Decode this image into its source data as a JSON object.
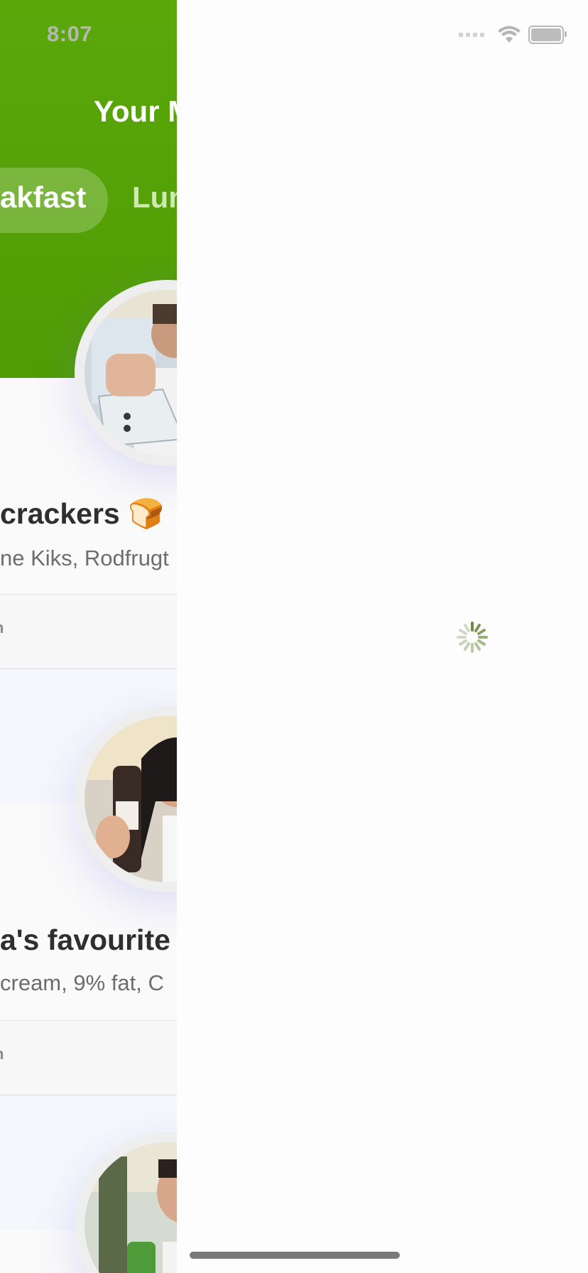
{
  "status_bar": {
    "time": "8:07"
  },
  "header": {
    "title": "Your M",
    "tabs": [
      {
        "label": "akfast",
        "active": true
      },
      {
        "label": "Lun",
        "active": false
      }
    ]
  },
  "meals": [
    {
      "title": "crackers",
      "emoji": "🍞",
      "subtitle": "ne Kiks, Rodfrugt",
      "action": "n"
    },
    {
      "title": "a's favourite",
      "subtitle": "cream, 9% fat, C",
      "action": "n"
    }
  ],
  "colors": {
    "header_green": "#5aa80a",
    "overlay_bg": "#fdfdfd",
    "spinner": "#6f8a45"
  },
  "overlay": {
    "state": "loading"
  }
}
